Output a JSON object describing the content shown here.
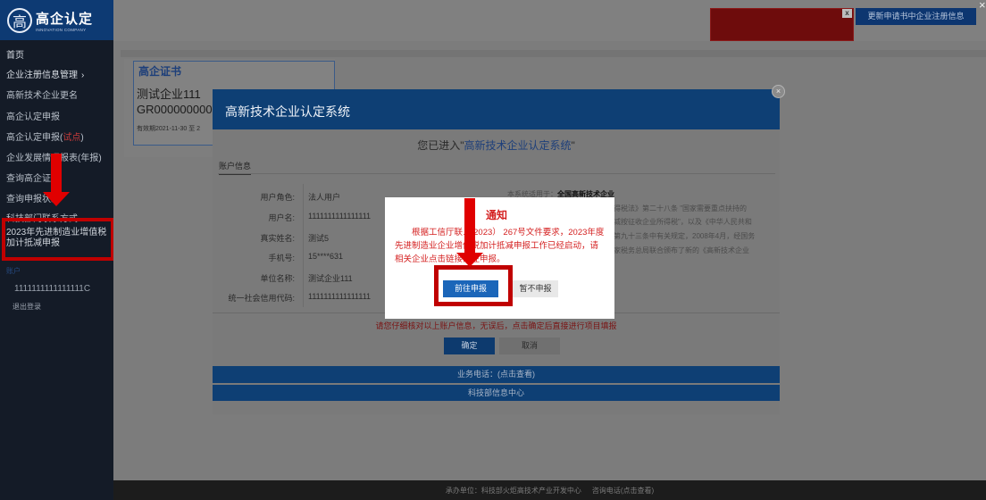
{
  "app": {
    "logo_mark": "高",
    "logo_title": "高企认定",
    "logo_subtitle": "INNOVATION COMPANY"
  },
  "sidebar": {
    "items": [
      {
        "label": "首页"
      },
      {
        "label": "企业注册信息管理",
        "chevron": "›"
      },
      {
        "label": "高新技术企业更名"
      },
      {
        "label": "高企认定申报"
      },
      {
        "label": "高企认定申报(",
        "highlight": "试点",
        "suffix": ")"
      },
      {
        "label": "企业发展情况报表(年报)"
      },
      {
        "label": "查询高企证书"
      },
      {
        "label": "查询申报状态"
      },
      {
        "label": "科技部门联系方式"
      }
    ],
    "highlighted_item": "2023年先进制造业增值税加计抵减申报",
    "user_section_label": "账户",
    "user_id": "1111111111111111C",
    "logout_label": "退出登录"
  },
  "top": {
    "update_button": "更新申请书中企业注册信息",
    "close_symbol": "×"
  },
  "cert": {
    "title": "高企证书",
    "company": "测试企业111",
    "number": "GR000000000",
    "validity": "有效期2021-11-30 至 2"
  },
  "dialog": {
    "title": "高新技术企业认定系统",
    "welcome_prefix": "您已进入\"",
    "welcome_system": "高新技术企业认定系统",
    "welcome_suffix": "\"",
    "tab_label": "账户信息",
    "fields": [
      {
        "label": "用户角色:",
        "value": "法人用户"
      },
      {
        "label": "用户名:",
        "value": "1111111111111111"
      },
      {
        "label": "真实姓名:",
        "value": "测试5"
      },
      {
        "label": "手机号:",
        "value": "15****631"
      },
      {
        "label": "单位名称:",
        "value": "测试企业111"
      },
      {
        "label": "统一社会信用代码:",
        "value": "1111111111111111"
      }
    ],
    "right_lines": [
      {
        "prefix": "本系统适用于：",
        "bold": "全国高新技术企业"
      },
      {
        "text": "得税法》第二十八条 \"国家需要重点扶持的"
      },
      {
        "text": "减按征收企业所得税\"，以及《中华人民共和"
      },
      {
        "text": "第九十三条中有关规定，2008年4月，经国务"
      },
      {
        "text": "家税务总局联合颁布了新的《高新技术企业"
      }
    ],
    "notice": "请您仔细核对以上账户信息，无误后，点击确定后直接进行项目填报",
    "confirm_label": "确定",
    "cancel_label": "取消",
    "phone_label": "业务电话：(点击查看)",
    "center_label": "科技部信息中心"
  },
  "popup": {
    "title": "通知",
    "body": "根据工信厅联… 2023） 267号文件要求，2023年度先进制造业企业增值税加计抵减申报工作已经启动，请相关企业点击链接前往申报。",
    "primary_label": "前往申报",
    "secondary_label": "暂不申报"
  },
  "footer": {
    "host": "承办单位：科技部火炬高技术产业开发中心",
    "contact": "咨询电话(点击查看)"
  },
  "colors": {
    "annotation_red": "#e00000",
    "brand_blue": "#0e3f74",
    "popup_red_text": "#d42020",
    "primary_button": "#1b66b9"
  }
}
